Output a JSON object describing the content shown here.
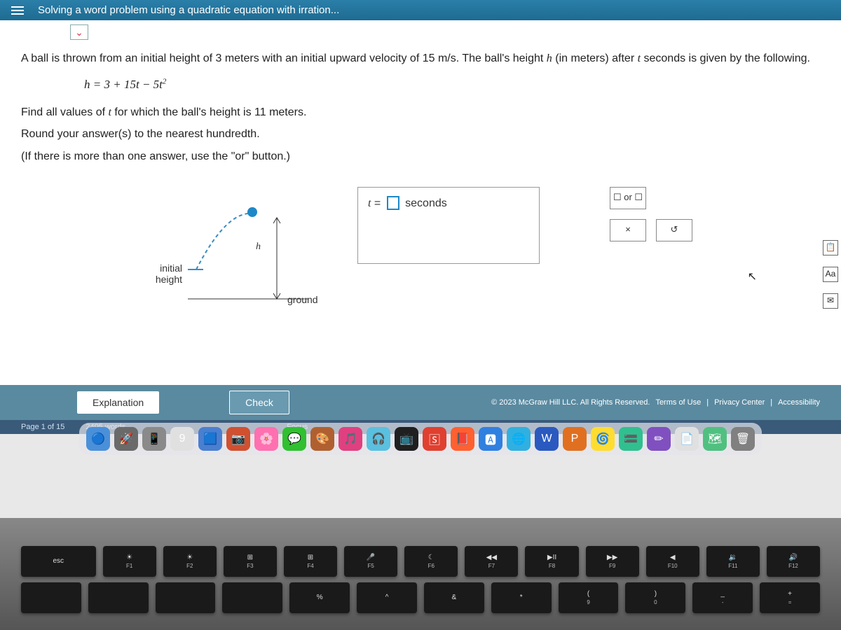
{
  "header": {
    "title": "Solving a word problem using a quadratic equation with irration..."
  },
  "problem": {
    "intro1": "A ball is thrown from an initial height of 3 meters with an initial upward velocity of 15 m/s. The ball's height ",
    "intro_h": "h",
    "intro2": " (in meters) after ",
    "intro_t": "t",
    "intro3": " seconds is given by the following.",
    "equation_lhs": "h",
    "equation_eq": " = 3 + 15",
    "equation_t1": "t",
    "equation_minus": " − 5",
    "equation_t2": "t",
    "find_line1": "Find all values of ",
    "find_t": "t",
    "find_line2": " for which the ball's height is 11 meters.",
    "round1": "Round your answer(s) to the nearest hundredth.",
    "round2": "(If there is more than one answer, use the \"or\" button.)"
  },
  "diagram": {
    "initial": "initial",
    "height": "height",
    "h": "h",
    "ground": "ground"
  },
  "answer": {
    "t": "t",
    "equals": "=",
    "unit": "seconds"
  },
  "tools": {
    "or": "☐ or ☐",
    "clear": "×",
    "reset": "↺"
  },
  "side": {
    "calc": "📋",
    "font": "Aa",
    "mail": "✉"
  },
  "footer": {
    "explanation": "Explanation",
    "check": "Check",
    "copyright": "© 2023 McGraw Hill LLC. All Rights Reserved.",
    "terms": "Terms of Use",
    "privacy": "Privacy Center",
    "accessibility": "Accessibility"
  },
  "word_status": {
    "page": "Page 1 of 15",
    "words": "2405 words",
    "focus": "Focus"
  },
  "dock": {
    "icons": [
      "🔵",
      "🚀",
      "📱",
      "9",
      "🟦",
      "📷",
      "🌸",
      "💬",
      "🎨",
      "🎵",
      "🎧",
      "📺",
      "🅂",
      "📕",
      "🅰",
      "🌐",
      "W",
      "P",
      "🌀",
      "🟰",
      "✏",
      "📄",
      "🗺",
      "🗑"
    ]
  },
  "keyboard": {
    "row1": [
      {
        "main": "esc",
        "sub": ""
      },
      {
        "main": "☀",
        "sub": "F1"
      },
      {
        "main": "☀",
        "sub": "F2"
      },
      {
        "main": "⊞",
        "sub": "F3"
      },
      {
        "main": "⊞",
        "sub": "F4"
      },
      {
        "main": "🎤",
        "sub": "F5"
      },
      {
        "main": "☾",
        "sub": "F6"
      },
      {
        "main": "◀◀",
        "sub": "F7"
      },
      {
        "main": "▶II",
        "sub": "F8"
      },
      {
        "main": "▶▶",
        "sub": "F9"
      },
      {
        "main": "◀",
        "sub": "F10"
      },
      {
        "main": "🔉",
        "sub": "F11"
      },
      {
        "main": "🔊",
        "sub": "F12"
      }
    ],
    "row2": [
      {
        "main": "",
        "sub": ""
      },
      {
        "main": "",
        "sub": ""
      },
      {
        "main": "",
        "sub": ""
      },
      {
        "main": "",
        "sub": ""
      },
      {
        "main": "%",
        "sub": ""
      },
      {
        "main": "^",
        "sub": ""
      },
      {
        "main": "&",
        "sub": ""
      },
      {
        "main": "*",
        "sub": ""
      },
      {
        "main": "(",
        "sub": "9"
      },
      {
        "main": ")",
        "sub": "0"
      },
      {
        "main": "_",
        "sub": "-"
      },
      {
        "main": "+",
        "sub": "="
      }
    ]
  }
}
